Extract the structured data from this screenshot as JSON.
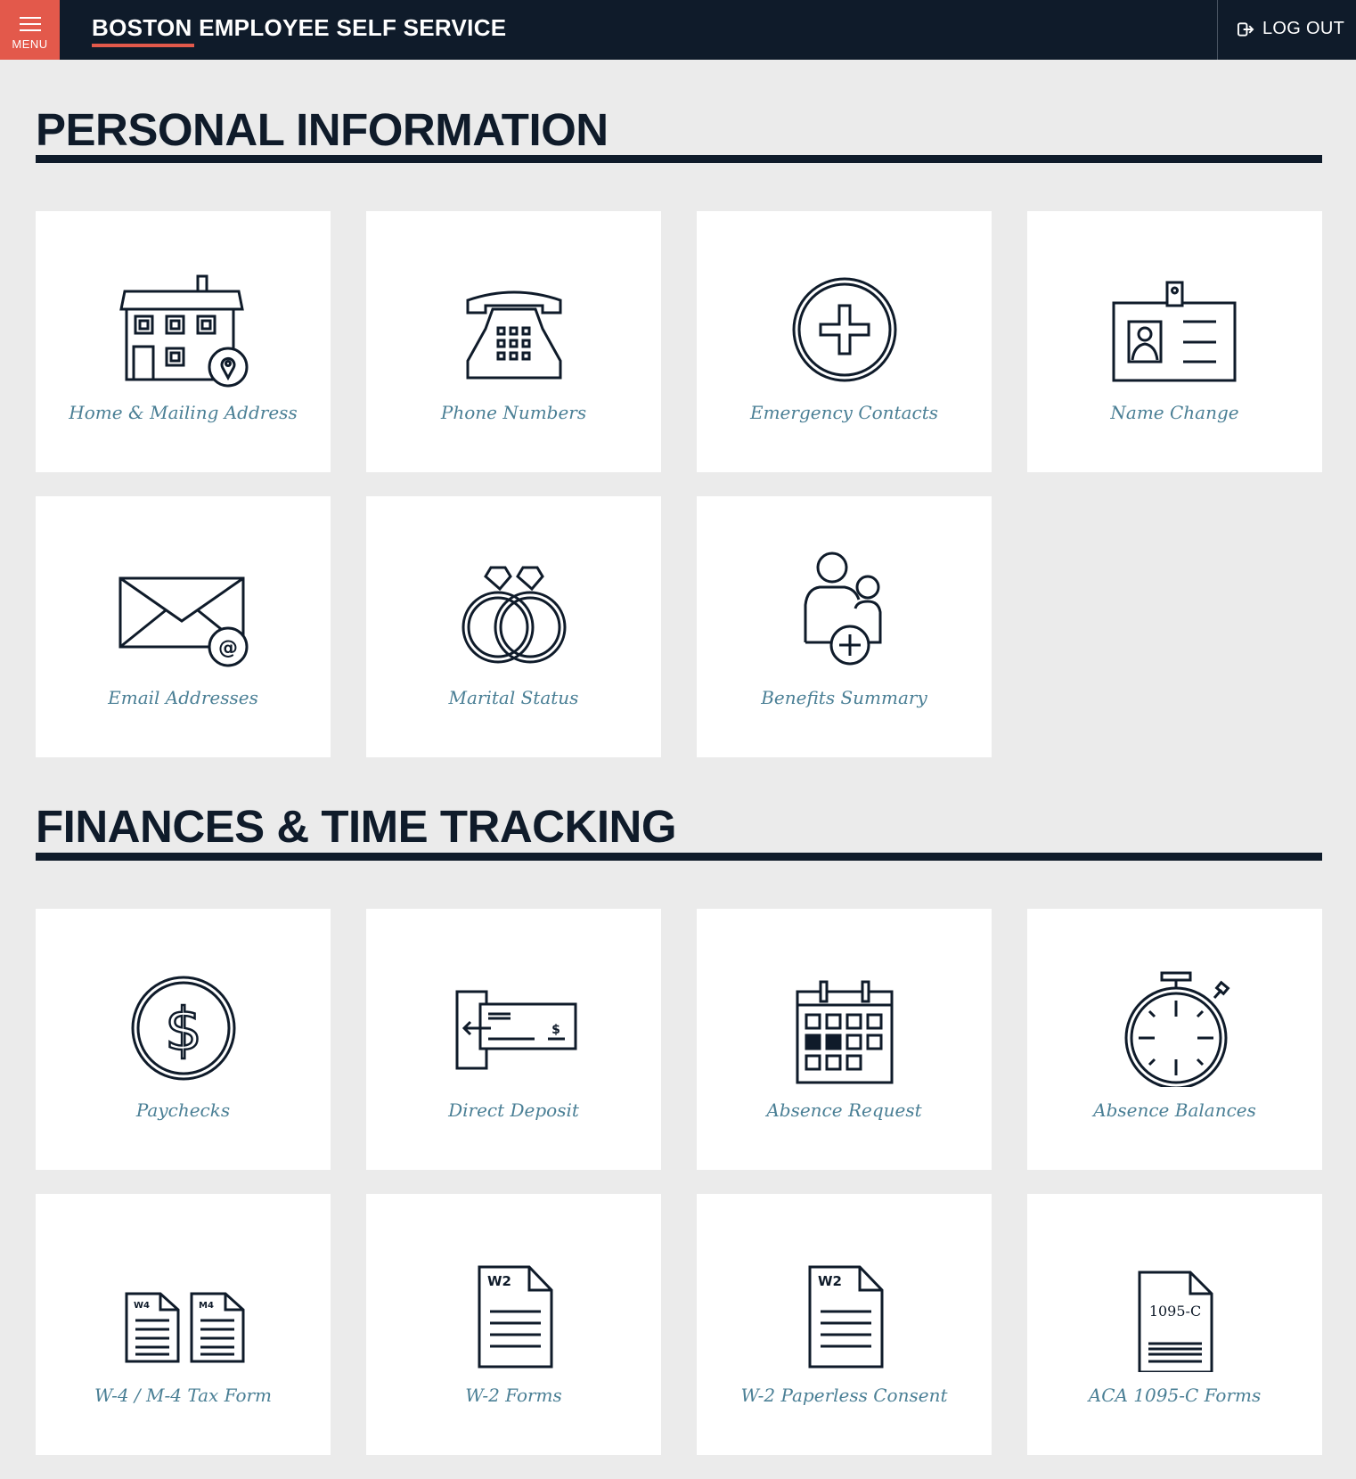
{
  "header": {
    "menu_label": "MENU",
    "app_title": "BOSTON EMPLOYEE SELF SERVICE",
    "logout_label": "LOG OUT"
  },
  "colors": {
    "navy": "#0f1b2a",
    "accent": "#e3594b",
    "tile_label": "#4a7f95",
    "background": "#ebebeb"
  },
  "sections": [
    {
      "title": "PERSONAL INFORMATION",
      "tiles": [
        {
          "label": "Home & Mailing Address",
          "icon": "house-location-icon"
        },
        {
          "label": "Phone Numbers",
          "icon": "telephone-icon"
        },
        {
          "label": "Emergency Contacts",
          "icon": "medical-cross-icon"
        },
        {
          "label": "Name Change",
          "icon": "id-badge-icon"
        },
        {
          "label": "Email Addresses",
          "icon": "envelope-at-icon"
        },
        {
          "label": "Marital Status",
          "icon": "wedding-rings-icon"
        },
        {
          "label": "Benefits Summary",
          "icon": "people-plus-icon"
        }
      ]
    },
    {
      "title": "FINANCES & TIME TRACKING",
      "tiles": [
        {
          "label": "Paychecks",
          "icon": "dollar-coin-icon"
        },
        {
          "label": "Direct Deposit",
          "icon": "check-deposit-icon"
        },
        {
          "label": "Absence Request",
          "icon": "calendar-icon"
        },
        {
          "label": "Absence Balances",
          "icon": "stopwatch-icon"
        },
        {
          "label": "W-4 / M-4 Tax Form",
          "icon": "tax-forms-icon",
          "doc_tags": [
            "W4",
            "M4"
          ]
        },
        {
          "label": "W-2 Forms",
          "icon": "w2-document-icon",
          "doc_tag": "W2"
        },
        {
          "label": "W-2 Paperless Consent",
          "icon": "w2-document-icon",
          "doc_tag": "W2"
        },
        {
          "label": "ACA 1095-C Forms",
          "icon": "form-1095c-icon",
          "doc_tag": "1095-C"
        }
      ]
    }
  ]
}
